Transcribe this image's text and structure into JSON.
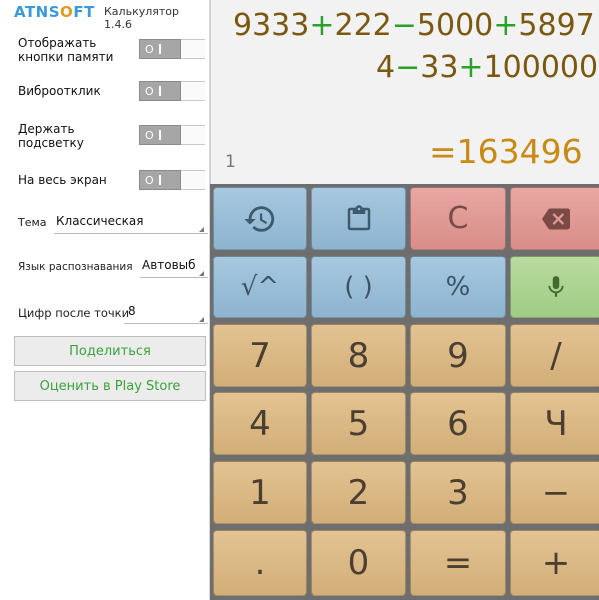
{
  "app": {
    "logo_prefix": "ATN",
    "logo_middle": "SOFT",
    "version": "Калькулятор 1.4.6"
  },
  "settings": {
    "memory_buttons": "Отображать кнопки памяти",
    "vibration": "Виброотклик",
    "keep_backlight": "Держать подсветку",
    "fullscreen": "На весь экран",
    "toggle_state": "O"
  },
  "selects": {
    "theme_label": "Тема",
    "theme_value": "Классическая",
    "language_label": "Язык распознавания",
    "language_value": "Автовыб",
    "digits_label": "Цифр после точки",
    "digits_value": "8"
  },
  "buttons": {
    "share": "Поделиться",
    "rate": "Оценить в Play Store"
  },
  "display": {
    "line1": [
      "9333",
      "+",
      "222",
      "−",
      "5000",
      "+",
      "5897"
    ],
    "line2": [
      "4",
      "−",
      "33",
      "+",
      "100000"
    ],
    "count": "1",
    "result": "=163496"
  },
  "keys": {
    "sqrt_pow": "√^",
    "paren": "( )",
    "percent": "%",
    "clear": "C",
    "k7": "7",
    "k8": "8",
    "k9": "9",
    "divide": "/",
    "k4": "4",
    "k5": "5",
    "k6": "6",
    "multiply": "Ч",
    "k1": "1",
    "k2": "2",
    "k3": "3",
    "minus": "−",
    "dot": ".",
    "k0": "0",
    "equals": "=",
    "plus": "+"
  },
  "colors": {
    "accent_green": "#3aa33a",
    "operator_green": "#2aa12a",
    "expression_brown": "#7a5810",
    "result_orange": "#c98a15",
    "key_tan": "#d9b782",
    "key_blue": "#95b9d4",
    "key_red": "#de9590",
    "key_green": "#a8d28d"
  },
  "icons": {
    "history": "history-icon",
    "paste": "clipboard-icon",
    "backspace": "backspace-icon",
    "voice": "microphone-icon"
  }
}
